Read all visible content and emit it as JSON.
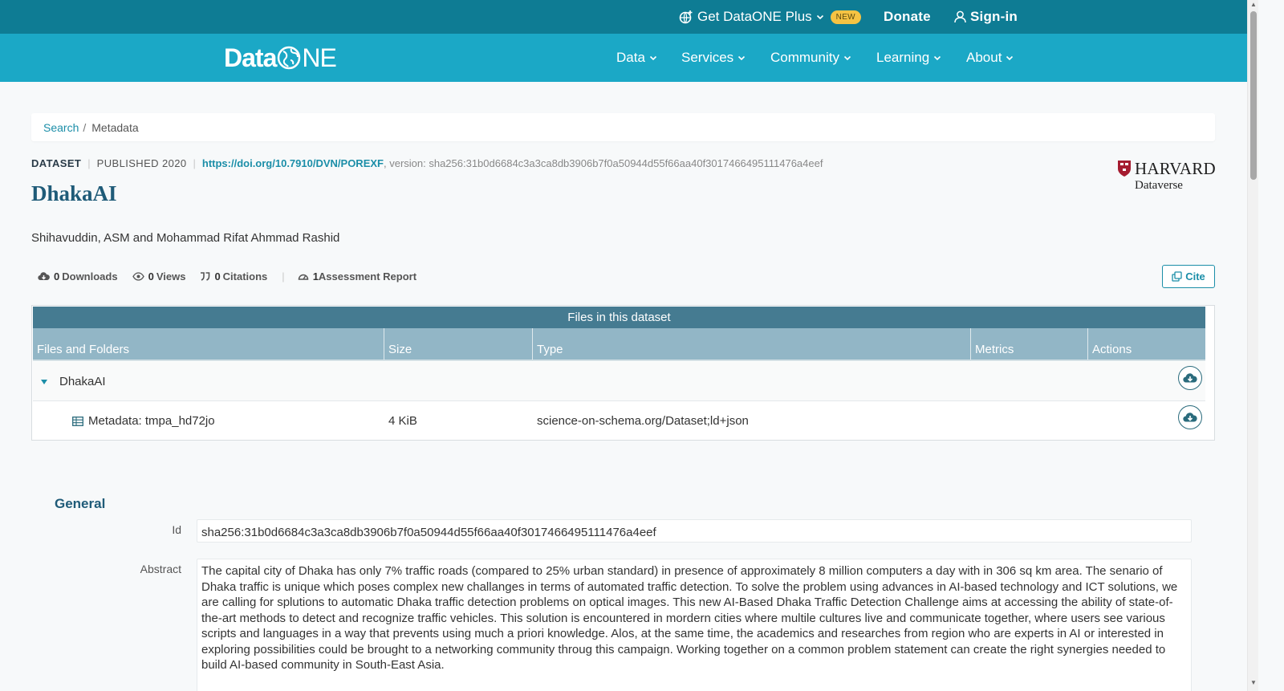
{
  "topbar": {
    "plus_label": "Get DataONE Plus",
    "plus_badge": "NEW",
    "donate_label": "Donate",
    "signin_label": "Sign-in"
  },
  "navbar": {
    "logo_left": "Data",
    "logo_right": "NE",
    "items": [
      {
        "label": "Data"
      },
      {
        "label": "Services"
      },
      {
        "label": "Community"
      },
      {
        "label": "Learning"
      },
      {
        "label": "About"
      }
    ]
  },
  "breadcrumb": {
    "search": "Search",
    "separator": "/",
    "current": "Metadata"
  },
  "dataset": {
    "kind": "DATASET",
    "published": "PUBLISHED 2020",
    "doi": "https://doi.org/10.7910/DVN/POREXF",
    "version": ", version: sha256:31b0d6684c3a3ca8db3906b7f0a50944d55f66aa40f3017466495111476a4eef",
    "title": "DhakaAI",
    "authors": "Shihavuddin, ASM and Mohammad Rifat Ahmmad Rashid",
    "repository_name": "HARVARD",
    "repository_sub": "Dataverse"
  },
  "stats": {
    "downloads_count": "0",
    "downloads_label": "Downloads",
    "views_count": "0",
    "views_label": "Views",
    "citations_count": "0",
    "citations_label": "Citations",
    "assessment_count": "1",
    "assessment_label": "Assessment Report"
  },
  "cite_label": "Cite",
  "files": {
    "heading": "Files in this dataset",
    "columns": [
      "Files and Folders",
      "Size",
      "Type",
      "Metrics",
      "Actions"
    ],
    "folder": {
      "name": "DhakaAI"
    },
    "rows": [
      {
        "name": "Metadata: tmpa_hd72jo",
        "size": "4 KiB",
        "type": "science-on-schema.org/Dataset;ld+json"
      }
    ]
  },
  "general": {
    "heading": "General",
    "id_label": "Id",
    "id_value": "sha256:31b0d6684c3a3ca8db3906b7f0a50944d55f66aa40f3017466495111476a4eef",
    "abstract_label": "Abstract",
    "abstract_value": "The capital city of Dhaka has only 7% traffic roads (compared to 25% urban standard) in presence of approximately 8 million computers a day with in 306 sq km area. The senario of Dhaka traffic is unique which poses complex new challanges in terms of automated traffic detection. To solve the problem using advances in AI-based technology and ICT solutions, we are calling for splutions to automatic Dhaka traffic detection problems on optical images. This new AI-Based Dhaka Traffic Detection Challenge aims at accessing the ability of state-of-the-art methods to detect and recognize traffic vehicles. This solution is encountered in mordern cities where multile cultures live and communicate together, where users see various scripts and languages in a way that prevents using much a priori knowledge. Alos, at the same time, the academics and researches from region who are experts in AI or interested in exploring possibilities could be brought to a networking community throug this campaign. Working together on a common problem statement can create the right synergies needed to build AI-based community in South-East Asia."
  },
  "colors": {
    "topbar": "#0e7c94",
    "navbar": "#1ba8c6",
    "accent": "#1b8ea8",
    "title": "#1f5b78",
    "files_header": "#457b91",
    "columns_header": "#92b6c6",
    "badge": "#f6c343"
  },
  "icons": {
    "plus": "globe-plus-icon",
    "signin": "user-icon",
    "downloads": "cloud-download-icon",
    "views": "eye-icon",
    "citations": "quote-icon",
    "assessment": "gauge-icon",
    "cite": "copy-icon",
    "folder_toggle": "caret-down-icon",
    "file": "table-icon",
    "download": "cloud-download-icon"
  }
}
